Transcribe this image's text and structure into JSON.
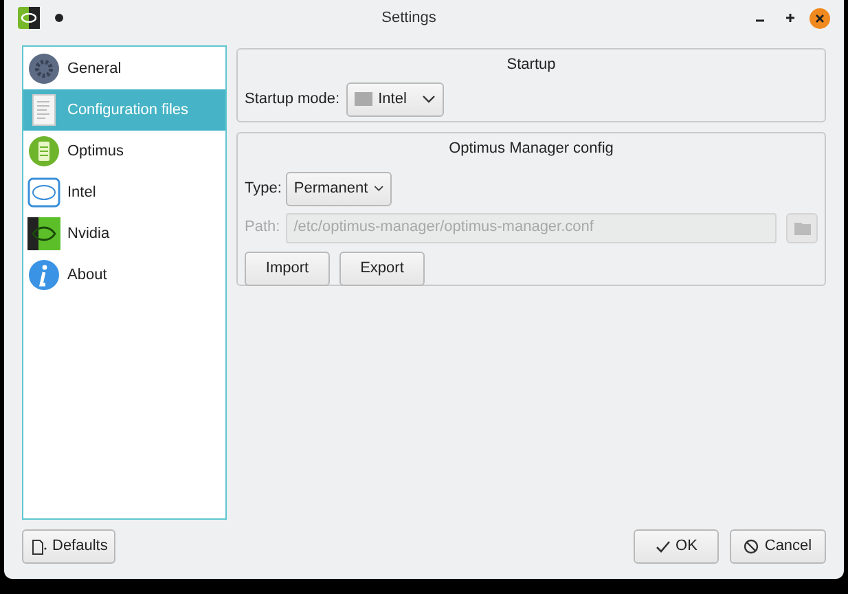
{
  "window": {
    "title": "Settings"
  },
  "sidebar": {
    "items": [
      {
        "label": "General",
        "selected": false
      },
      {
        "label": "Configuration files",
        "selected": true
      },
      {
        "label": "Optimus",
        "selected": false
      },
      {
        "label": "Intel",
        "selected": false
      },
      {
        "label": "Nvidia",
        "selected": false
      },
      {
        "label": "About",
        "selected": false
      }
    ]
  },
  "startup": {
    "title": "Startup",
    "mode_label": "Startup mode:",
    "mode_value": "Intel"
  },
  "config": {
    "title": "Optimus Manager config",
    "type_label": "Type:",
    "type_value": "Permanent",
    "path_label": "Path:",
    "path_value": "/etc/optimus-manager/optimus-manager.conf",
    "path_disabled": true,
    "buttons": [
      "Import",
      "Export"
    ]
  },
  "footer": {
    "defaults": "Defaults",
    "ok": "OK",
    "cancel": "Cancel"
  }
}
